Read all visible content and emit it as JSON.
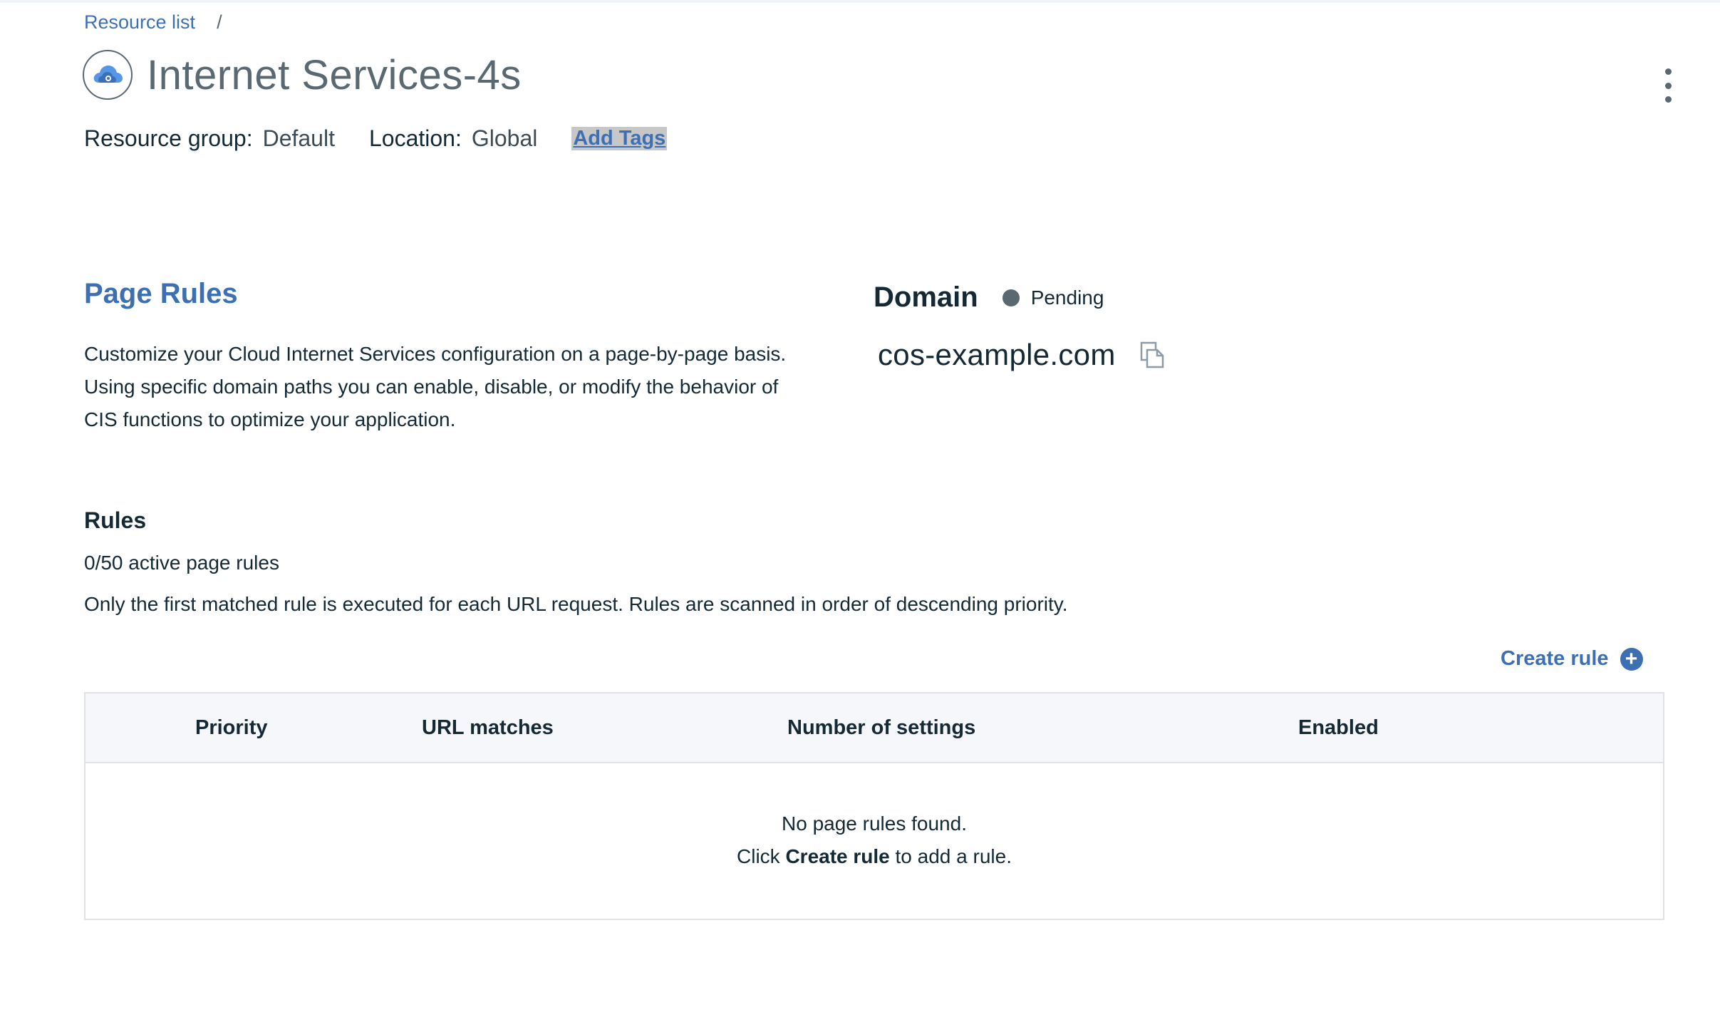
{
  "breadcrumb": {
    "items": [
      {
        "label": "Resource list"
      }
    ],
    "separator": "/"
  },
  "header": {
    "title": "Internet Services-4s",
    "icon": "cloud-internet-services-icon",
    "overflow_icon": "overflow-menu-vertical-icon"
  },
  "meta": {
    "resource_group_label": "Resource group:",
    "resource_group_value": "Default",
    "location_label": "Location:",
    "location_value": "Global",
    "add_tags_label": "Add Tags"
  },
  "page_rules": {
    "title": "Page Rules",
    "description": "Customize your Cloud Internet Services configuration on a page-by-page basis. Using specific domain paths you can enable, disable, or modify the behavior of CIS functions to optimize your application."
  },
  "domain": {
    "label": "Domain",
    "status": "Pending",
    "status_color": "#5a6872",
    "value": "cos-example.com",
    "copy_icon": "copy-icon"
  },
  "rules": {
    "title": "Rules",
    "count_text": "0/50 active page rules",
    "note": "Only the first matched rule is executed for each URL request. Rules are scanned in order of descending priority.",
    "create_label": "Create rule",
    "create_icon": "add-filled-icon"
  },
  "table": {
    "columns": [
      "Priority",
      "URL matches",
      "Number of settings",
      "Enabled"
    ],
    "empty": {
      "line1": "No page rules found.",
      "line2_prefix": "Click ",
      "line2_bold": "Create rule",
      "line2_suffix": " to add a rule."
    }
  },
  "colors": {
    "accent": "#3d70b2",
    "text": "#152935",
    "muted": "#5a6872",
    "header_bg": "#f5f7fa",
    "border": "#dfe3e6"
  }
}
